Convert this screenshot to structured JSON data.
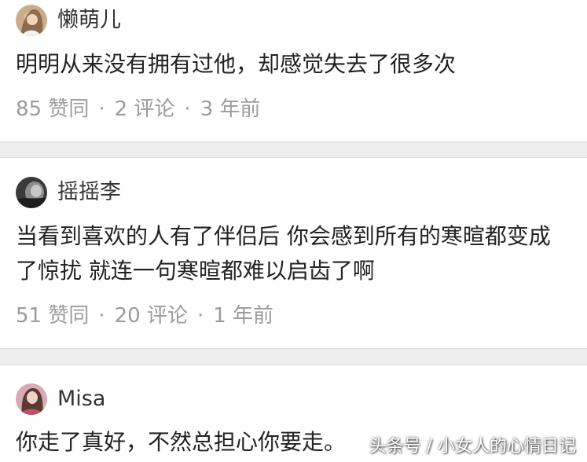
{
  "comments": [
    {
      "username": "懒萌儿",
      "text": "明明从来没有拥有过他，却感觉失去了很多次",
      "likes": "85 赞同",
      "replies": "2 评论",
      "time": "3 年前"
    },
    {
      "username": "摇摇李",
      "text": "当看到喜欢的人有了伴侣后 你会感到所有的寒暄都变成了惊扰 就连一句寒暄都难以启齿了啊",
      "likes": "51 赞同",
      "replies": "20 评论",
      "time": "1 年前"
    },
    {
      "username": "Misa",
      "text": "你走了真好，不然总担心你要走。"
    }
  ],
  "separator": "·",
  "watermark": "头条号 / 小女人的心情日记",
  "colors": {
    "background": "#ffffff",
    "divider": "#eeeeee",
    "text": "#222222",
    "meta": "#9b9b9b"
  }
}
